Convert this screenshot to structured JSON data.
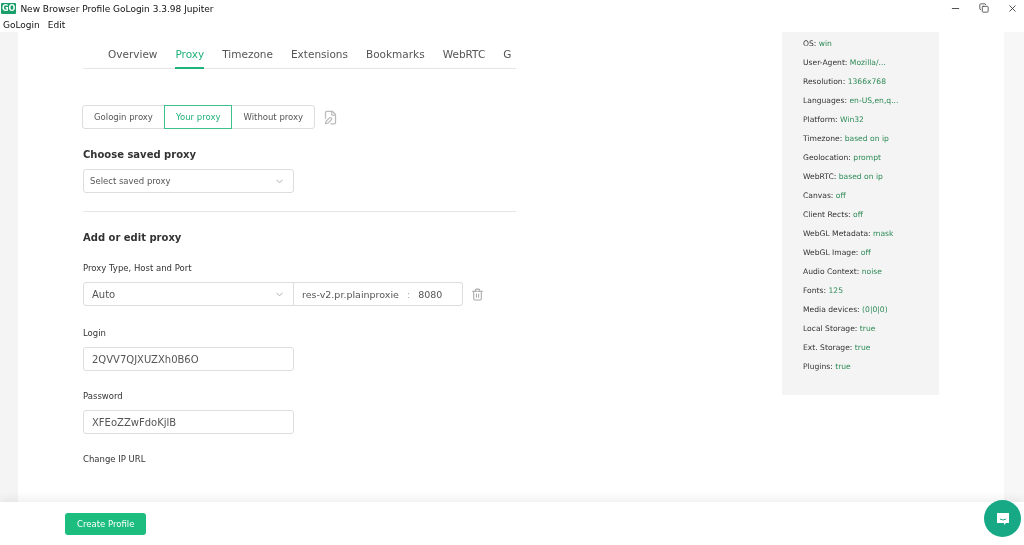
{
  "window": {
    "title": "New Browser Profile GoLogin 3.3.98 Jupiter",
    "logo": "GO"
  },
  "menu": [
    "GoLogin",
    "Edit"
  ],
  "tabs": [
    {
      "label": "Overview",
      "selected": false
    },
    {
      "label": "Proxy",
      "selected": true
    },
    {
      "label": "Timezone",
      "selected": false
    },
    {
      "label": "Extensions",
      "selected": false
    },
    {
      "label": "Bookmarks",
      "selected": false
    },
    {
      "label": "WebRTC",
      "selected": false
    },
    {
      "label": "G",
      "selected": false
    }
  ],
  "proxy_modes": [
    {
      "label": "Gologin proxy",
      "selected": false
    },
    {
      "label": "Your proxy",
      "selected": true
    },
    {
      "label": "Without proxy",
      "selected": false
    }
  ],
  "saved_proxy": {
    "heading": "Choose saved proxy",
    "placeholder": "Select saved proxy"
  },
  "edit_proxy": {
    "heading": "Add or edit proxy",
    "type_label": "Proxy Type, Host and Port",
    "type": "Auto",
    "host": "res-v2.pr.plainproxie",
    "separator": ":",
    "port": "8080",
    "login_label": "Login",
    "login": "2QVV7QJXUZXh0B6O",
    "password_label": "Password",
    "password": "XFEoZZwFdoKjlB",
    "change_ip_label": "Change IP URL"
  },
  "summary": [
    {
      "key": "OS:",
      "value": "win"
    },
    {
      "key": "User-Agent:",
      "value": "Mozilla/..."
    },
    {
      "key": "Resolution:",
      "value": "1366x768"
    },
    {
      "key": "Languages:",
      "value": "en-US,en,q..."
    },
    {
      "key": "Platform:",
      "value": "Win32"
    },
    {
      "key": "Timezone:",
      "value": "based on ip"
    },
    {
      "key": "Geolocation:",
      "value": "prompt"
    },
    {
      "key": "WebRTC:",
      "value": "based on ip"
    },
    {
      "key": "Canvas:",
      "value": "off"
    },
    {
      "key": "Client Rects:",
      "value": "off"
    },
    {
      "key": "WebGL Metadata:",
      "value": "mask"
    },
    {
      "key": "WebGL Image:",
      "value": "off"
    },
    {
      "key": "Audio Context:",
      "value": "noise"
    },
    {
      "key": "Fonts:",
      "value": "125"
    },
    {
      "key": "Media devices:",
      "value": "(0|0|0)"
    },
    {
      "key": "Local Storage:",
      "value": "true"
    },
    {
      "key": "Ext. Storage:",
      "value": "true"
    },
    {
      "key": "Plugins:",
      "value": "true"
    }
  ],
  "footer": {
    "button": "Create Profile"
  }
}
